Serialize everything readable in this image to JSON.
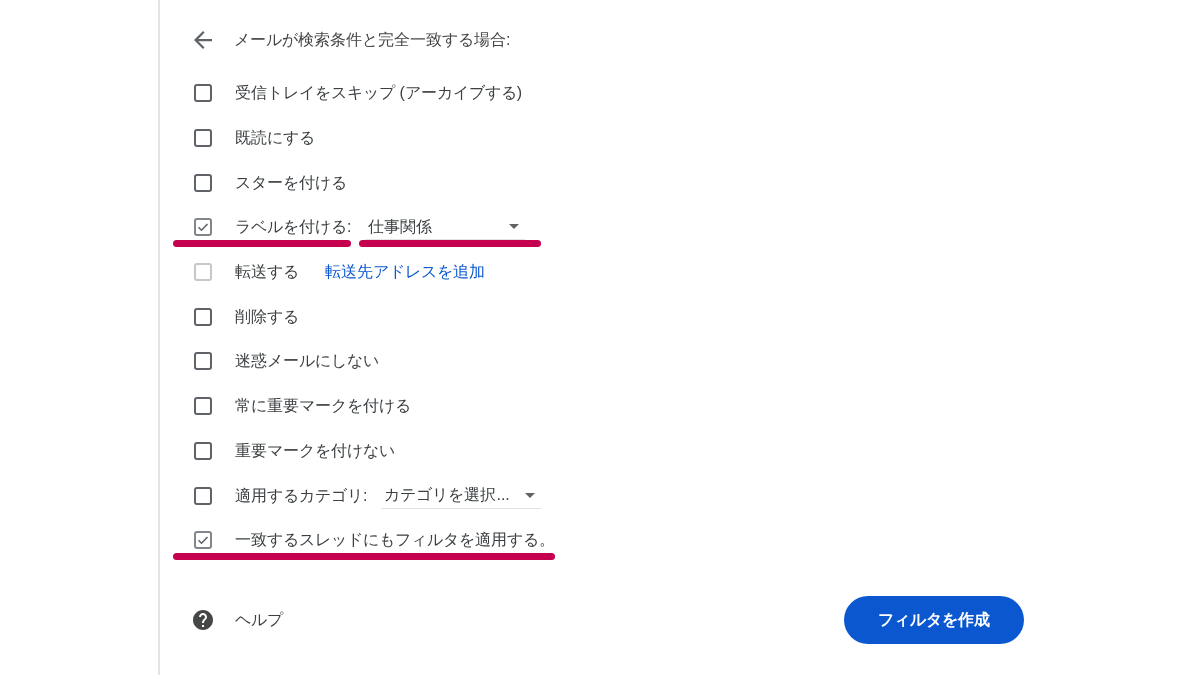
{
  "header": {
    "title": "メールが検索条件と完全一致する場合:"
  },
  "options": [
    {
      "kind": "plain",
      "label": "受信トレイをスキップ (アーカイブする)",
      "checked": false,
      "disabled": false,
      "marked": false
    },
    {
      "kind": "plain",
      "label": "既読にする",
      "checked": false,
      "disabled": false,
      "marked": false
    },
    {
      "kind": "plain",
      "label": "スターを付ける",
      "checked": false,
      "disabled": false,
      "marked": false
    },
    {
      "kind": "select",
      "label": "ラベルを付ける:",
      "checked": true,
      "disabled": false,
      "marked": true,
      "select": {
        "value": "仕事関係",
        "marked": true
      }
    },
    {
      "kind": "link",
      "label": "転送する",
      "checked": false,
      "disabled": true,
      "marked": false,
      "link": "転送先アドレスを追加"
    },
    {
      "kind": "plain",
      "label": "削除する",
      "checked": false,
      "disabled": false,
      "marked": false
    },
    {
      "kind": "plain",
      "label": "迷惑メールにしない",
      "checked": false,
      "disabled": false,
      "marked": false
    },
    {
      "kind": "plain",
      "label": "常に重要マークを付ける",
      "checked": false,
      "disabled": false,
      "marked": false
    },
    {
      "kind": "plain",
      "label": "重要マークを付けない",
      "checked": false,
      "disabled": false,
      "marked": false
    },
    {
      "kind": "select",
      "label": "適用するカテゴリ:",
      "checked": false,
      "disabled": false,
      "marked": false,
      "select": {
        "value": "カテゴリを選択...",
        "marked": false
      }
    },
    {
      "kind": "plain",
      "label": "一致するスレッドにもフィルタを適用する。",
      "checked": true,
      "disabled": false,
      "marked": true
    }
  ],
  "help": {
    "label": "ヘルプ"
  },
  "create_button": {
    "label": "フィルタを作成"
  }
}
